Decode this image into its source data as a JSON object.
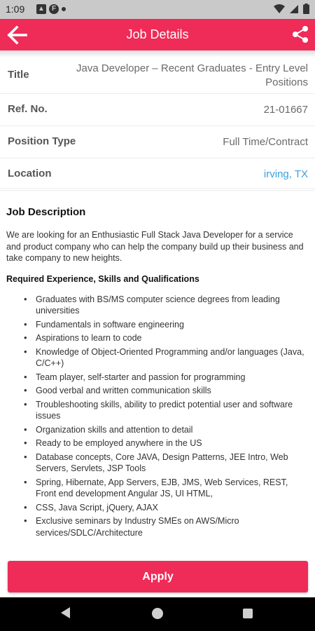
{
  "status_bar": {
    "time": "1:09",
    "icon_names": [
      "photos-icon",
      "flipboard-icon",
      "dot-icon",
      "wifi-icon",
      "signal-icon",
      "battery-icon"
    ]
  },
  "app_bar": {
    "title": "Job Details",
    "icons": [
      "back-arrow-icon",
      "share-icon"
    ]
  },
  "details": {
    "title_label": "Title",
    "title_value": "Java Developer – Recent Graduates - Entry Level Positions",
    "ref_label": "Ref. No.",
    "ref_value": "21-01667",
    "type_label": "Position Type",
    "type_value": "Full Time/Contract",
    "location_label": "Location",
    "location_value": "irving, TX"
  },
  "description": {
    "heading": "Job Description",
    "intro": "We are looking for an Enthusiastic Full Stack Java Developer for a service and product company who can help the company build up their business and take company to new heights.",
    "subheading": "Required Experience, Skills and Qualifications",
    "items": [
      "Graduates with BS/MS computer science degrees from leading universities",
      "Fundamentals in software engineering",
      "Aspirations to learn to code",
      "Knowledge of Object-Oriented Programming and/or languages (Java, C/C++)",
      "Team player, self-starter and passion for programming",
      "Good verbal and written communication skills",
      "Troubleshooting skills, ability to predict potential user and software issues",
      "Organization skills and attention to detail",
      "Ready to be employed anywhere in the US",
      "Database concepts, Core JAVA, Design Patterns, JEE Intro, Web Servers, Servlets, JSP Tools",
      "Spring, Hibernate, App Servers, EJB, JMS, Web Services, REST, Front end development Angular JS, UI HTML,",
      "CSS, Java Script, jQuery, AJAX",
      "Exclusive seminars by Industry SMEs on AWS/Micro services/SDLC/Architecture"
    ]
  },
  "apply_button": {
    "label": "Apply"
  },
  "colors": {
    "accent": "#ef2b57",
    "link": "#3aa0dd",
    "status_bar": "#c9c9c9",
    "nav_bar": "#000000"
  },
  "nav_bar": {
    "icons": [
      "nav-back-icon",
      "nav-home-icon",
      "nav-recents-icon"
    ]
  }
}
